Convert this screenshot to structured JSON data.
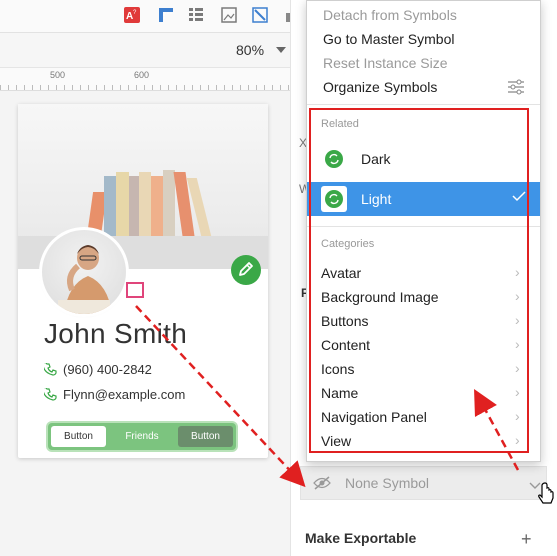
{
  "toolbar": {
    "icons": [
      "text-style-icon",
      "ruler-icon",
      "grid-icon",
      "image-icon",
      "vector-icon",
      "layers-icon"
    ]
  },
  "zoom": {
    "value": "80%"
  },
  "ruler": {
    "ticks": [
      "500",
      "600"
    ]
  },
  "card": {
    "name": "John Smith",
    "phone": "(960) 400-2842",
    "email": "Flynn@example.com",
    "buttons": [
      "Button",
      "Friends",
      "Button"
    ]
  },
  "menu": {
    "items": [
      "Detach from Symbols",
      "Go to Master Symbol",
      "Reset Instance Size",
      "Organize Symbols"
    ],
    "related_header": "Related",
    "related": [
      "Dark",
      "Light"
    ],
    "categories_header": "Categories",
    "categories": [
      "Avatar",
      "Background Image",
      "Buttons",
      "Content",
      "Icons",
      "Name",
      "Navigation Panel",
      "View"
    ]
  },
  "panel": {
    "symbol_value": "None Symbol",
    "make_exportable": "Make Exportable",
    "stubs": [
      "X",
      "W",
      "F"
    ]
  },
  "colors": {
    "accent_blue": "#3e94e7",
    "accent_green": "#3aa847",
    "annotation_red": "#e02020",
    "selection_pink": "#e0457b"
  }
}
